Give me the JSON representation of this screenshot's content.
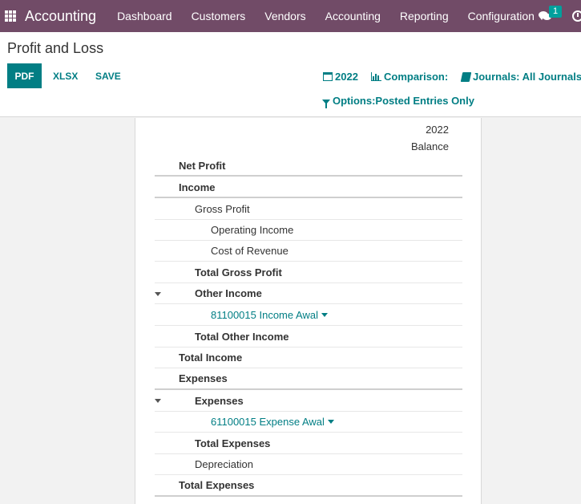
{
  "navbar": {
    "brand": "Accounting",
    "menu": [
      "Dashboard",
      "Customers",
      "Vendors",
      "Accounting",
      "Reporting",
      "Configuration"
    ],
    "chat_badge": "1",
    "bg_color": "#714b67"
  },
  "control_panel": {
    "title": "Profit and Loss",
    "buttons": {
      "pdf": "PDF",
      "xlsx": "XLSX",
      "save": "SAVE"
    },
    "filters": {
      "period": "2022",
      "comparison": "Comparison:",
      "journals": "Journals: All Journals",
      "options": "Options:Posted Entries Only"
    },
    "accent_color": "#017e84"
  },
  "report": {
    "column_year": "2022",
    "column_label": "Balance",
    "lines": [
      {
        "label": "Net Profit"
      },
      {
        "label": "Income"
      },
      {
        "label": "Gross Profit"
      },
      {
        "label": "Operating Income"
      },
      {
        "label": "Cost of Revenue"
      },
      {
        "label": "Total Gross Profit"
      },
      {
        "label": "Other Income"
      },
      {
        "label": "81100015 Income Awal"
      },
      {
        "label": "Total Other Income"
      },
      {
        "label": "Total Income"
      },
      {
        "label": "Expenses"
      },
      {
        "label": "Expenses"
      },
      {
        "label": "61100015 Expense Awal"
      },
      {
        "label": "Total Expenses"
      },
      {
        "label": "Depreciation"
      },
      {
        "label": "Total Expenses"
      }
    ]
  }
}
